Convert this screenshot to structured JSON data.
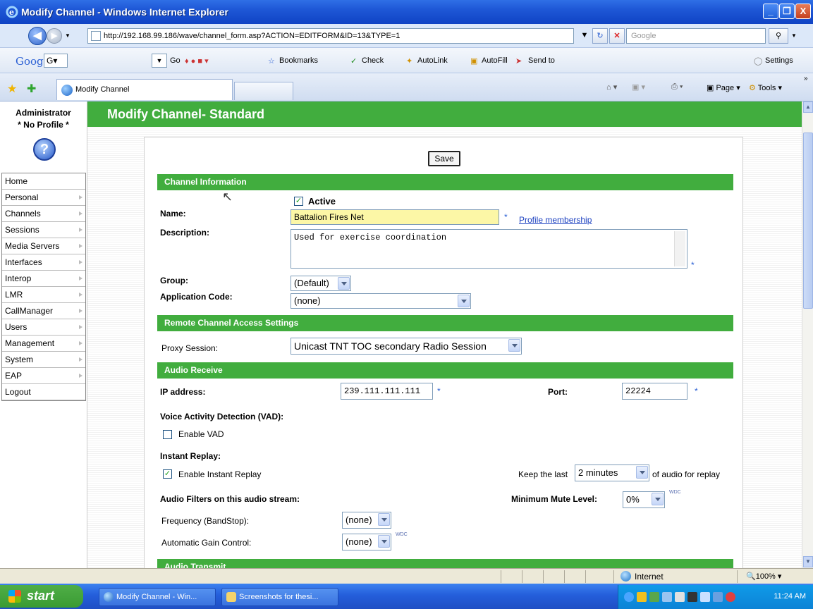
{
  "window": {
    "title": "Modify Channel - Windows Internet Explorer",
    "minimize": "_",
    "maximize": "❐",
    "close": "X"
  },
  "address_bar": {
    "url": "http://192.168.99.186/wave/channel_form.asp?ACTION=EDITFORM&ID=13&TYPE=1",
    "search_placeholder": "Google"
  },
  "google_toolbar": {
    "logo": "Google",
    "go_label": "Go",
    "bookmarks": "Bookmarks",
    "check": "Check",
    "autolink": "AutoLink",
    "autofill": "AutoFill",
    "send_to": "Send to",
    "settings": "Settings"
  },
  "tabs": {
    "active_tab": "Modify Channel"
  },
  "command_bar": {
    "page": "Page",
    "tools": "Tools"
  },
  "sidebar": {
    "user": "Administrator",
    "profile": "* No Profile *",
    "help_symbol": "?",
    "items": [
      {
        "label": "Home",
        "submenu": false
      },
      {
        "label": "Personal",
        "submenu": true
      },
      {
        "label": "Channels",
        "submenu": true
      },
      {
        "label": "Sessions",
        "submenu": true
      },
      {
        "label": "Media Servers",
        "submenu": true
      },
      {
        "label": "Interfaces",
        "submenu": true
      },
      {
        "label": "Interop",
        "submenu": true
      },
      {
        "label": "LMR",
        "submenu": true
      },
      {
        "label": "CallManager",
        "submenu": true
      },
      {
        "label": "Users",
        "submenu": true
      },
      {
        "label": "Management",
        "submenu": true
      },
      {
        "label": "System",
        "submenu": true
      },
      {
        "label": "EAP",
        "submenu": true
      },
      {
        "label": "Logout",
        "submenu": false
      }
    ]
  },
  "main": {
    "header": "Modify Channel- Standard",
    "save_label": "Save",
    "channel_info": {
      "section": "Channel Information",
      "active_label": "Active",
      "active_checked": true,
      "name_label": "Name:",
      "name_value": "Battalion Fires Net",
      "required": "*",
      "profile_link": "Profile membership",
      "description_label": "Description:",
      "description_value": "Used for exercise coordination",
      "group_label": "Group:",
      "group_value": "(Default)",
      "appcode_label": "Application Code:",
      "appcode_value": "(none)"
    },
    "remote_access": {
      "section": "Remote Channel Access Settings",
      "proxy_label": "Proxy Session:",
      "proxy_value": "Unicast TNT TOC secondary Radio Session"
    },
    "audio_receive": {
      "section": "Audio Receive",
      "ip_label": "IP address:",
      "ip_value": "239.111.111.111",
      "port_label": "Port:",
      "port_value": "22224",
      "vad_heading": "Voice Activity Detection (VAD):",
      "vad_label": "Enable VAD",
      "vad_checked": false,
      "replay_heading": "Instant Replay:",
      "replay_label": "Enable Instant Replay",
      "replay_checked": true,
      "keep_prefix": "Keep the last",
      "keep_value": "2 minutes",
      "keep_suffix": "of audio for replay",
      "filters_heading": "Audio Filters on this audio stream:",
      "mute_label": "Minimum Mute Level:",
      "mute_value": "0%",
      "wdc": "WDC",
      "freq_label": "Frequency (BandStop):",
      "freq_value": "(none)",
      "agc_label": "Automatic Gain Control:",
      "agc_value": "(none)"
    },
    "audio_transmit": {
      "section": "Audio Transmit"
    }
  },
  "status_bar": {
    "zone": "Internet",
    "zoom": "100%"
  },
  "taskbar": {
    "start": "start",
    "tasks": [
      "Modify Channel - Win...",
      "Screenshots for thesi..."
    ],
    "clock": "11:24 AM"
  }
}
